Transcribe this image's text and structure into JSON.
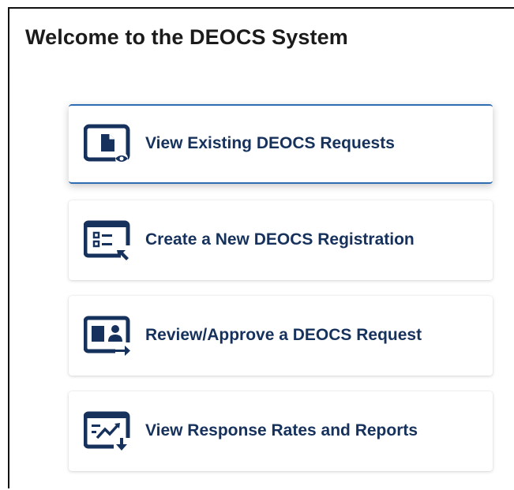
{
  "header": {
    "title": "Welcome to the DEOCS System"
  },
  "cards": [
    {
      "label": "View Existing DEOCS Requests",
      "icon": "view-requests-icon"
    },
    {
      "label": "Create a New DEOCS Registration",
      "icon": "create-registration-icon"
    },
    {
      "label": "Review/Approve a DEOCS Request",
      "icon": "review-approve-icon"
    },
    {
      "label": "View Response Rates and Reports",
      "icon": "response-rates-icon"
    }
  ],
  "colors": {
    "primary_text": "#16325c",
    "icon_navy": "#16325c",
    "active_border": "#2f6db3",
    "title_text": "#1b1b1b"
  }
}
